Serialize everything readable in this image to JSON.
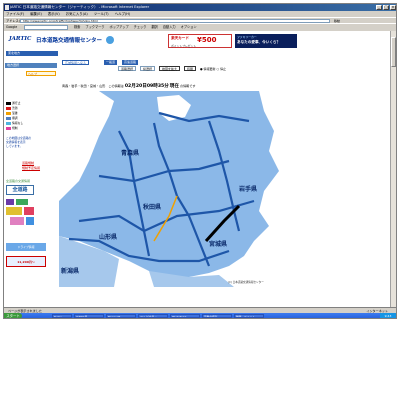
{
  "window": {
    "title": "JARTIC 日本道路交通情報センター（ジャーティック） - Microsoft Internet Explorer",
    "minimize": "_",
    "maximize": "□",
    "close": "×"
  },
  "menu": [
    "ファイル(F)",
    "編集(E)",
    "表示(V)",
    "お気に入り(A)",
    "ツール(T)",
    "ヘルプ(H)"
  ],
  "address": {
    "label": "アドレス(D)",
    "url": "http://www.jartic.or.jp/traffic/highway/tohoku.html",
    "go_label": "移動"
  },
  "google_bar": {
    "label": "Google",
    "items": [
      "検索",
      "ブックマーク",
      "ポップアップ",
      "チェック",
      "翻訳",
      "自動入力",
      "オプション"
    ]
  },
  "header": {
    "logo_text": "JARTIC",
    "org_name": "日本道路交通情報センター",
    "banner_yen": {
      "brand": "楽天カード",
      "amount": "¥500",
      "sub": "ポイントプレゼント"
    },
    "banner_ad": {
      "line1": "ファミリーカー",
      "line2": "あなたの愛車、今いくら？"
    },
    "tab_left": "東北地方",
    "tabs": [
      "広域情報へ戻る",
      "一般道",
      "高速道路"
    ],
    "selects": [
      "道路選択",
      "県選択"
    ],
    "buttons": [
      "地図を拡大",
      "印刷"
    ],
    "radios": [
      "情報更新",
      "停止"
    ]
  },
  "sidebar": {
    "top_label": "地方選択",
    "help_link": "ヘルプ",
    "legend": [
      {
        "label": "通行止",
        "color": "#000000"
      },
      {
        "label": "渋滞",
        "color": "#d81b1b"
      },
      {
        "label": "混雑",
        "color": "#f0a000"
      },
      {
        "label": "順調",
        "color": "#4f7fc0"
      },
      {
        "label": "情報なし",
        "color": "#4fb4e0"
      },
      {
        "label": "規制",
        "color": "#e040a0"
      }
    ],
    "notes": [
      "この地図は全道路の",
      "交通情報を表示",
      "しています。"
    ],
    "links": [
      "道路規制",
      "規制予定情報"
    ],
    "area_heading": "全道路の交通情報",
    "all_road": "全道路",
    "banner1": "ドライブ情報",
    "banner2": "11,200円〜"
  },
  "content": {
    "breadcrumb": "青森・岩手・秋田・宮城・山形　この情報は",
    "timestamp": "02月20日09時35分",
    "status_word": "現在",
    "suffix": "の情報です"
  },
  "map": {
    "prefectures": [
      "青森県",
      "秋田県",
      "岩手県",
      "山形県",
      "宮城県",
      "新潟県"
    ],
    "copyright": "(C) 日本道路交通情報センター"
  },
  "statusbar": {
    "left": "ページが表示されました",
    "right": "インターネット"
  },
  "taskbar": {
    "start": "スタート",
    "tasks": [
      "Today",
      "JARTIC日...",
      "Microsoft...",
      "マイ ピクチャ",
      "PhotoPaint",
      "画像の保存",
      "無題 - ペイント"
    ],
    "clock": "9:43"
  },
  "colors": {
    "sea": "#ffffff",
    "land": "#8bb8e8",
    "road": "#1e56a8",
    "closed": "#000000"
  }
}
